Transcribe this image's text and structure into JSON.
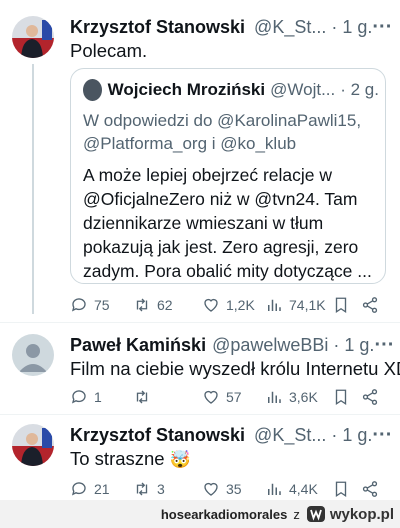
{
  "tweet1": {
    "author": "Krzysztof Stanowski",
    "handle": "@K_St...",
    "time": "· 1 g.",
    "text": "Polecam.",
    "quote": {
      "author": "Wojciech Mroziński",
      "handle": "@Wojt...",
      "time": "· 2 g.",
      "reply_line1": "W odpowiedzi do @KarolinaPawli15,",
      "reply_line2": "@Platforma_org i @ko_klub",
      "lines": [
        "A może lepiej obejrzeć relacje w",
        "@OficjalneZero niż w @tvn24. Tam",
        "dziennikarze wmieszani w tłum",
        "pokazują jak jest. Zero agresji, zero",
        "zadym. Pora obalić mity dotyczące ..."
      ]
    },
    "stats": {
      "replies": "75",
      "retweets": "62",
      "likes": "1,2K",
      "views": "74,1K"
    }
  },
  "tweet2": {
    "author": "Paweł Kamiński",
    "handle": "@pawelweBBi",
    "time": "· 1 g.",
    "text": "Film na ciebie wyszedł królu Internetu XD",
    "stats": {
      "replies": "1",
      "retweets": "",
      "likes": "57",
      "views": "3,6K"
    }
  },
  "tweet3": {
    "author": "Krzysztof Stanowski",
    "handle": "@K_St...",
    "time": "· 1 g.",
    "text": "To straszne",
    "emoji": "🤯",
    "stats": {
      "replies": "21",
      "retweets": "3",
      "likes": "35",
      "views": "4,4K"
    }
  },
  "footer": {
    "user": "hosearkadiomorales",
    "suffix": "z",
    "brand": "wykop.pl"
  },
  "colors": {
    "accent": "#1d9bf0",
    "muted": "#536471",
    "border": "#cfd9de"
  }
}
